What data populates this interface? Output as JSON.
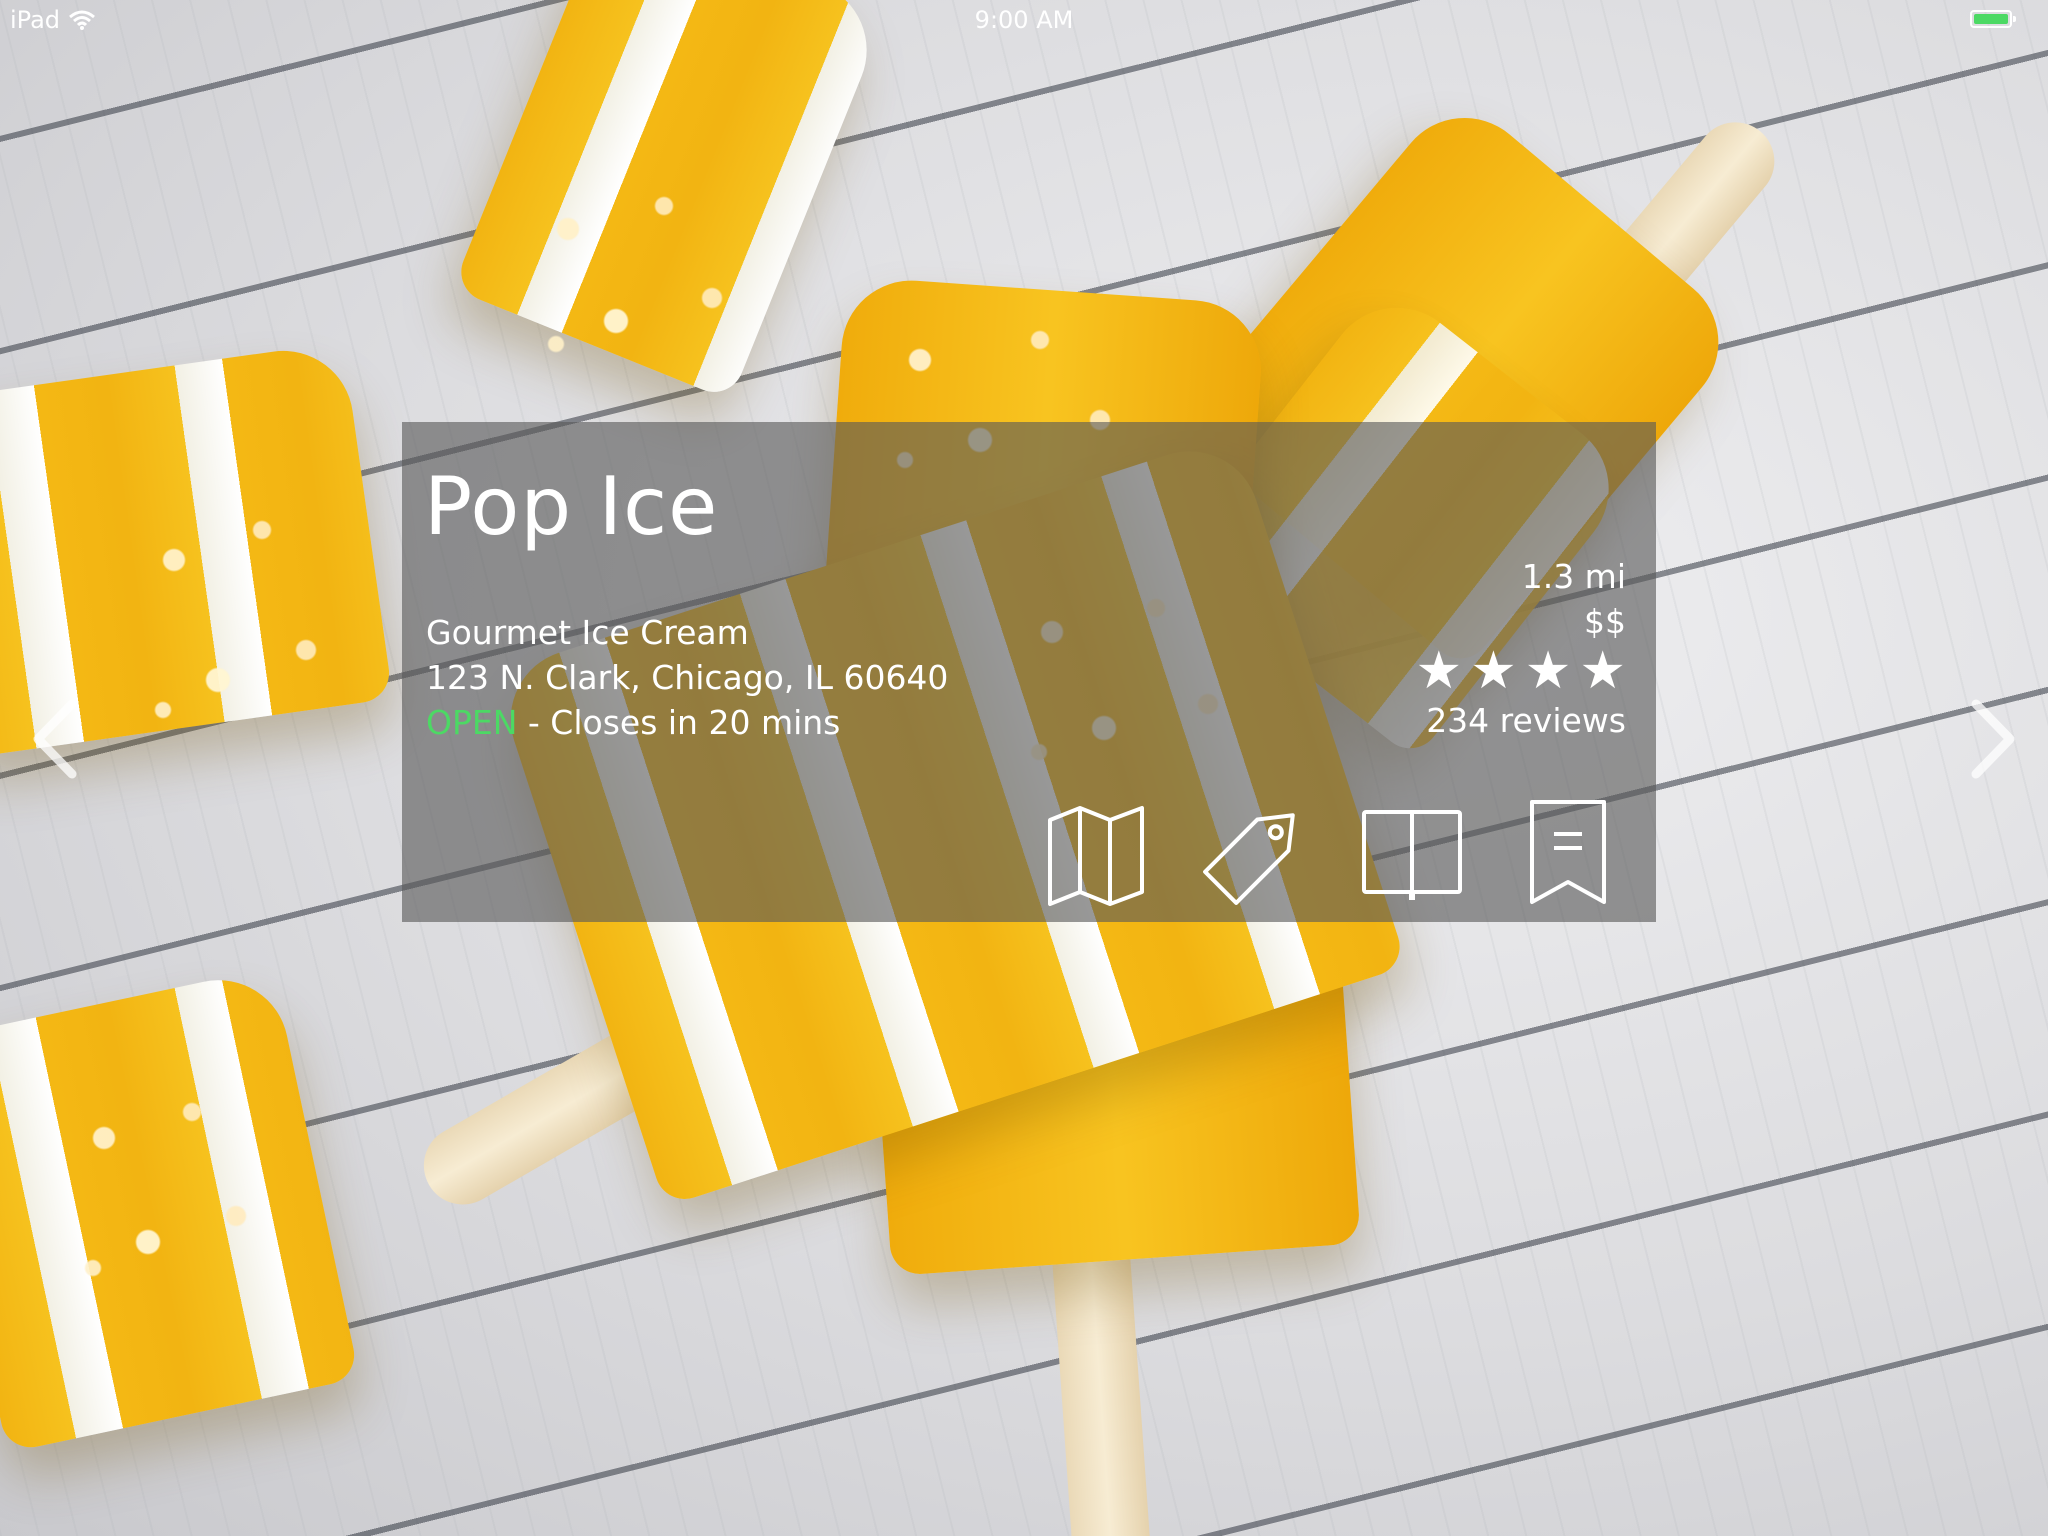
{
  "status_bar": {
    "device": "iPad",
    "time": "9:00 AM",
    "battery_level": 1.0,
    "battery_color": "#4cd964"
  },
  "venue": {
    "name": "Pop Ice",
    "category": "Gourmet Ice Cream",
    "address": "123 N. Clark, Chicago, IL 60640",
    "open_status": "OPEN",
    "hours_note": " - Closes in 20 mins",
    "distance": "1.3 mi",
    "price": "$$",
    "rating_stars": 4,
    "reviews": "234 reviews"
  },
  "actions": [
    {
      "icon": "map-icon"
    },
    {
      "icon": "tag-icon"
    },
    {
      "icon": "book-icon"
    },
    {
      "icon": "bookmark-icon"
    }
  ],
  "navigation": {
    "prev_icon": "chevron-left-icon",
    "next_icon": "chevron-right-icon"
  },
  "colors": {
    "open": "#4cd964",
    "card_overlay": "rgba(88,88,88,0.62)"
  }
}
